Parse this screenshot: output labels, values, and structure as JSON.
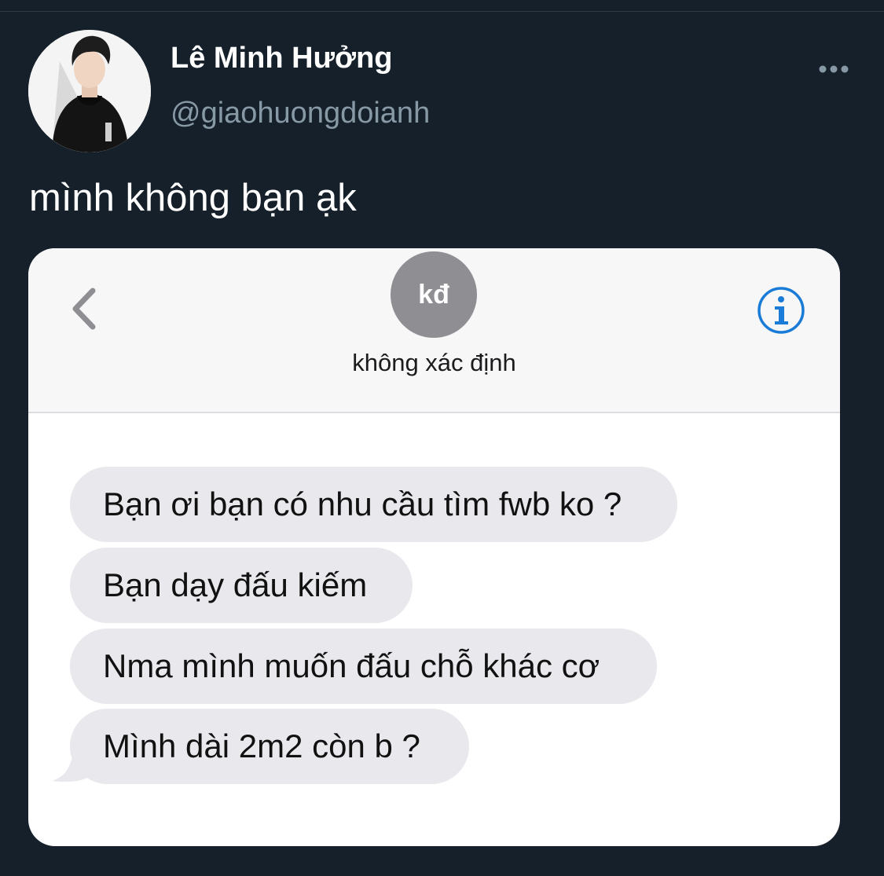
{
  "tweet": {
    "display_name": "Lê Minh Hưởng",
    "handle": "@giaohuongdoianh",
    "text": "mình không bạn ạk",
    "more_icon": "more-horizontal-icon"
  },
  "screenshot": {
    "contact_initials": "kđ",
    "contact_name": "không xác định",
    "back_icon": "chevron-left-icon",
    "info_icon": "info-icon",
    "accent_color": "#1a7cd6",
    "messages": [
      "Bạn ơi bạn có nhu cầu tìm fwb ko ?",
      "Bạn dạy đấu kiếm",
      "Nma mình muốn đấu chỗ khác cơ",
      "Mình dài 2m2 còn b ?"
    ]
  },
  "colors": {
    "background": "#15202b",
    "handle": "#8899a6",
    "bubble": "#e8e8ed"
  }
}
